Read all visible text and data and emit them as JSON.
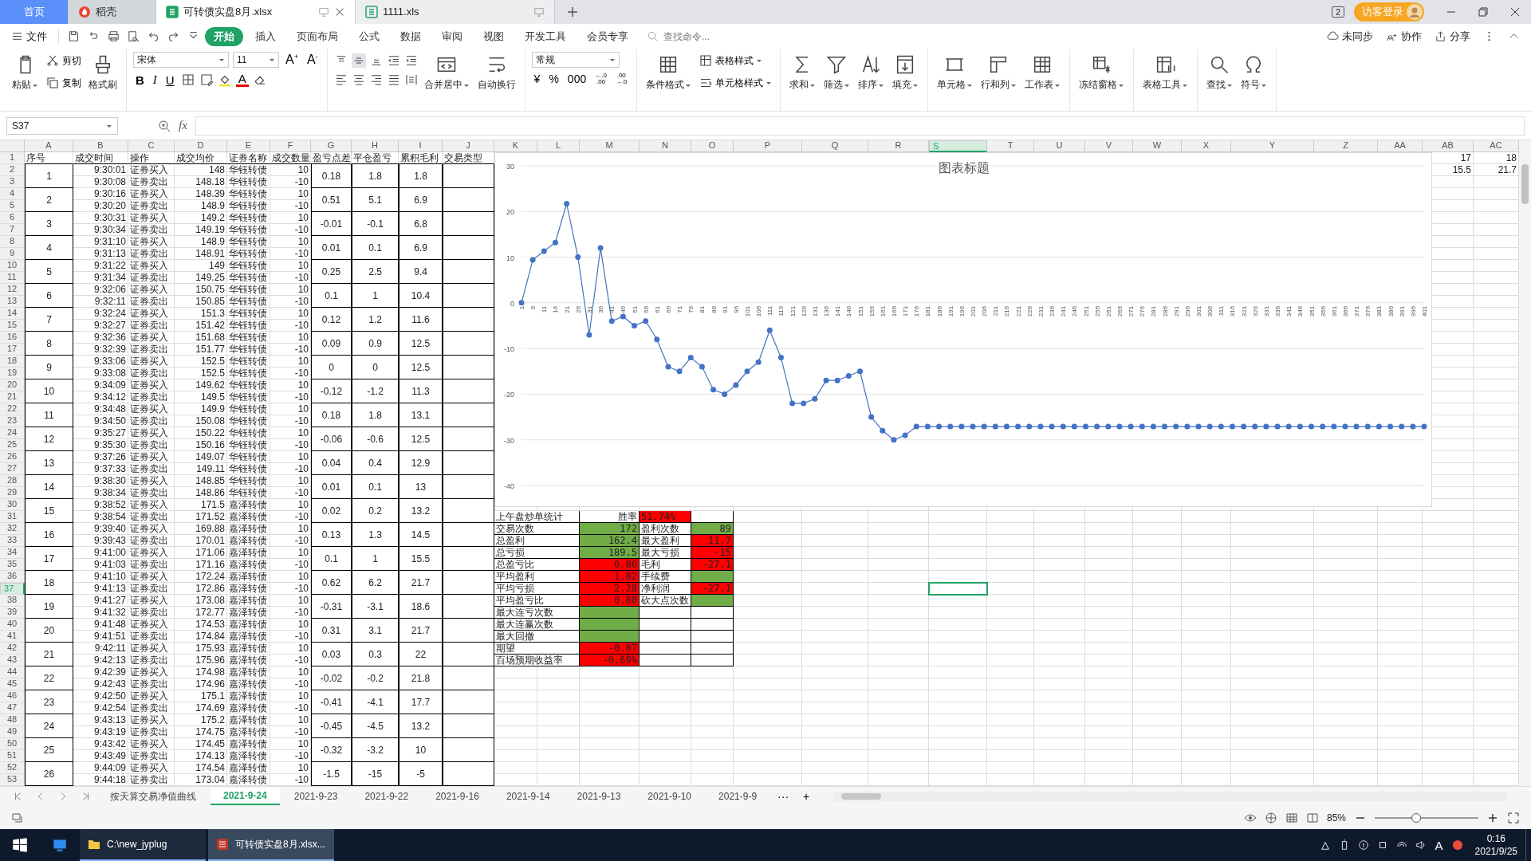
{
  "doc_tabs": [
    {
      "label": "首页",
      "selected": false,
      "kind": "home"
    },
    {
      "label": "稻壳",
      "selected": false,
      "kind": "app"
    },
    {
      "label": "可转债实盘8月.xlsx",
      "selected": true,
      "kind": "sheet"
    },
    {
      "label": "1111.xls",
      "selected": false,
      "kind": "sheet"
    }
  ],
  "screen_badge": "2",
  "login": "访客登录",
  "file_menu": "文件",
  "menu_tabs": [
    {
      "label": "开始",
      "selected": true
    },
    {
      "label": "插入",
      "selected": false
    },
    {
      "label": "页面布局",
      "selected": false
    },
    {
      "label": "公式",
      "selected": false
    },
    {
      "label": "数据",
      "selected": false
    },
    {
      "label": "审阅",
      "selected": false
    },
    {
      "label": "视图",
      "selected": false
    },
    {
      "label": "开发工具",
      "selected": false
    },
    {
      "label": "会员专享",
      "selected": false
    }
  ],
  "command_search": {
    "placeholder": "查找命令..."
  },
  "menu_actions": [
    "未同步",
    "协作",
    "分享"
  ],
  "ribbon_groups": [
    {
      "items": [
        {
          "kind": "big",
          "label": "粘贴",
          "menu": true
        },
        {
          "kind": "stack",
          "items": [
            {
              "label": "剪切",
              "menu": false
            },
            {
              "label": "复制",
              "menu": false
            }
          ]
        },
        {
          "kind": "big",
          "label": "格式刷",
          "menu": false
        }
      ]
    },
    {
      "items": [
        {
          "kind": "font",
          "font": "宋体",
          "size": "11",
          "grow": {
            "text": "A",
            "mark": "+"
          },
          "shrink": {
            "text": "A",
            "mark": "-"
          },
          "styles": [
            "B",
            "I",
            "U"
          ],
          "color_label": "A"
        }
      ]
    },
    {
      "items": [
        {
          "kind": "align"
        },
        {
          "kind": "big",
          "label": "合并居中",
          "menu": true
        },
        {
          "kind": "big",
          "label": "自动换行",
          "menu": false
        }
      ]
    },
    {
      "items": [
        {
          "kind": "number",
          "format": "常规",
          "symbols": [
            "¥",
            "%",
            "000"
          ],
          "decimals": [
            {
              "top": "←.0",
              "bottom": ".00"
            },
            {
              "top": ".00",
              "bottom": "→.0"
            }
          ]
        }
      ]
    },
    {
      "items": [
        {
          "kind": "big",
          "label": "条件格式",
          "menu": true
        },
        {
          "kind": "stack",
          "items": [
            {
              "label": "表格样式",
              "menu": true
            },
            {
              "label": "单元格样式",
              "menu": true
            }
          ]
        }
      ]
    },
    {
      "items": [
        {
          "kind": "big",
          "label": "求和",
          "menu": true
        },
        {
          "kind": "big",
          "label": "筛选",
          "menu": true
        },
        {
          "kind": "big",
          "label": "排序",
          "menu": true
        },
        {
          "kind": "big",
          "label": "填充",
          "menu": true
        }
      ]
    },
    {
      "items": [
        {
          "kind": "big",
          "label": "单元格",
          "menu": true
        },
        {
          "kind": "big",
          "label": "行和列",
          "menu": true
        },
        {
          "kind": "big",
          "label": "工作表",
          "menu": true
        }
      ]
    },
    {
      "items": [
        {
          "kind": "big",
          "label": "冻结窗格",
          "menu": true
        }
      ]
    },
    {
      "items": [
        {
          "kind": "big",
          "label": "表格工具",
          "menu": true
        }
      ]
    },
    {
      "items": [
        {
          "kind": "big",
          "label": "查找",
          "menu": true
        },
        {
          "kind": "big",
          "label": "符号",
          "menu": true
        }
      ]
    }
  ],
  "formula_bar": {
    "cell": "S37",
    "fx": "fx"
  },
  "sheet": {
    "columns": [
      {
        "label": "A",
        "selected": false
      },
      {
        "label": "B",
        "selected": false
      },
      {
        "label": "C",
        "selected": false
      },
      {
        "label": "D",
        "selected": false
      },
      {
        "label": "E",
        "selected": false
      },
      {
        "label": "F",
        "selected": false
      },
      {
        "label": "G",
        "selected": false
      },
      {
        "label": "H",
        "selected": false
      },
      {
        "label": "I",
        "selected": false
      },
      {
        "label": "J",
        "selected": false
      },
      {
        "label": "K",
        "selected": false
      },
      {
        "label": "L",
        "selected": false
      },
      {
        "label": "M",
        "selected": false
      },
      {
        "label": "N",
        "selected": false
      },
      {
        "label": "O",
        "selected": false
      },
      {
        "label": "P",
        "selected": false
      },
      {
        "label": "Q",
        "selected": false
      },
      {
        "label": "R",
        "selected": false
      },
      {
        "label": "S",
        "selected": true
      },
      {
        "label": "T",
        "selected": false
      },
      {
        "label": "U",
        "selected": false
      },
      {
        "label": "V",
        "selected": false
      },
      {
        "label": "W",
        "selected": false
      },
      {
        "label": "X",
        "selected": false
      },
      {
        "label": "Y",
        "selected": false
      },
      {
        "label": "Z",
        "selected": false
      },
      {
        "label": "AA",
        "selected": false
      },
      {
        "label": "AB",
        "selected": false
      },
      {
        "label": "AC",
        "selected": false
      }
    ],
    "rows": [
      {
        "label": "1",
        "selected": false
      },
      {
        "label": "2",
        "selected": false
      },
      {
        "label": "3",
        "selected": false
      },
      {
        "label": "4",
        "selected": false
      },
      {
        "label": "5",
        "selected": false
      },
      {
        "label": "6",
        "selected": false
      },
      {
        "label": "7",
        "selected": false
      },
      {
        "label": "8",
        "selected": false
      },
      {
        "label": "9",
        "selected": false
      },
      {
        "label": "10",
        "selected": false
      },
      {
        "label": "11",
        "selected": false
      },
      {
        "label": "12",
        "selected": false
      },
      {
        "label": "13",
        "selected": false
      },
      {
        "label": "14",
        "selected": false
      },
      {
        "label": "15",
        "selected": false
      },
      {
        "label": "16",
        "selected": false
      },
      {
        "label": "17",
        "selected": false
      },
      {
        "label": "18",
        "selected": false
      },
      {
        "label": "19",
        "selected": false
      },
      {
        "label": "20",
        "selected": false
      },
      {
        "label": "21",
        "selected": false
      },
      {
        "label": "22",
        "selected": false
      },
      {
        "label": "23",
        "selected": false
      },
      {
        "label": "24",
        "selected": false
      },
      {
        "label": "25",
        "selected": false
      },
      {
        "label": "26",
        "selected": false
      },
      {
        "label": "27",
        "selected": false
      },
      {
        "label": "28",
        "selected": false
      },
      {
        "label": "29",
        "selected": false
      },
      {
        "label": "30",
        "selected": false
      },
      {
        "label": "31",
        "selected": false
      },
      {
        "label": "32",
        "selected": false
      },
      {
        "label": "33",
        "selected": false
      },
      {
        "label": "34",
        "selected": false
      },
      {
        "label": "35",
        "selected": false
      },
      {
        "label": "36",
        "selected": false
      },
      {
        "label": "37",
        "selected": true
      },
      {
        "label": "38",
        "selected": false
      },
      {
        "label": "39",
        "selected": false
      },
      {
        "label": "40",
        "selected": false
      },
      {
        "label": "41",
        "selected": false
      },
      {
        "label": "42",
        "selected": false
      },
      {
        "label": "43",
        "selected": false
      },
      {
        "label": "44",
        "selected": false
      },
      {
        "label": "45",
        "selected": false
      },
      {
        "label": "46",
        "selected": false
      },
      {
        "label": "47",
        "selected": false
      },
      {
        "label": "48",
        "selected": false
      },
      {
        "label": "49",
        "selected": false
      },
      {
        "label": "50",
        "selected": false
      },
      {
        "label": "51",
        "selected": false
      },
      {
        "label": "52",
        "selected": false
      },
      {
        "label": "53",
        "selected": false
      }
    ],
    "headers": [
      "序号",
      "成交时间",
      "操作",
      "成交均价",
      "证券名称",
      "成交数量",
      "盈亏点差",
      "平仓盈亏",
      "累积毛利",
      "交易类型"
    ],
    "trades": [
      {
        "no": "1",
        "legs": [
          {
            "time": "9:30:01",
            "action": "证券买入",
            "price": "148",
            "security": "华钰转债",
            "qty": "10"
          },
          {
            "time": "9:30:08",
            "action": "证券卖出",
            "price": "148.18",
            "security": "华钰转债",
            "qty": "-10"
          }
        ],
        "diff": "0.18",
        "pnl": "1.8",
        "cum": "1.8"
      },
      {
        "no": "2",
        "legs": [
          {
            "time": "9:30:16",
            "action": "证券买入",
            "price": "148.39",
            "security": "华钰转债",
            "qty": "10"
          },
          {
            "time": "9:30:20",
            "action": "证券卖出",
            "price": "148.9",
            "security": "华钰转债",
            "qty": "-10"
          }
        ],
        "diff": "0.51",
        "pnl": "5.1",
        "cum": "6.9"
      },
      {
        "no": "3",
        "legs": [
          {
            "time": "9:30:31",
            "action": "证券买入",
            "price": "149.2",
            "security": "华钰转债",
            "qty": "10"
          },
          {
            "time": "9:30:34",
            "action": "证券卖出",
            "price": "149.19",
            "security": "华钰转债",
            "qty": "-10"
          }
        ],
        "diff": "-0.01",
        "pnl": "-0.1",
        "cum": "6.8"
      },
      {
        "no": "4",
        "legs": [
          {
            "time": "9:31:10",
            "action": "证券买入",
            "price": "148.9",
            "security": "华钰转债",
            "qty": "10"
          },
          {
            "time": "9:31:13",
            "action": "证券卖出",
            "price": "148.91",
            "security": "华钰转债",
            "qty": "-10"
          }
        ],
        "diff": "0.01",
        "pnl": "0.1",
        "cum": "6.9"
      },
      {
        "no": "5",
        "legs": [
          {
            "time": "9:31:22",
            "action": "证券买入",
            "price": "149",
            "security": "华钰转债",
            "qty": "10"
          },
          {
            "time": "9:31:34",
            "action": "证券卖出",
            "price": "149.25",
            "security": "华钰转债",
            "qty": "-10"
          }
        ],
        "diff": "0.25",
        "pnl": "2.5",
        "cum": "9.4"
      },
      {
        "no": "6",
        "legs": [
          {
            "time": "9:32:06",
            "action": "证券买入",
            "price": "150.75",
            "security": "华钰转债",
            "qty": "10"
          },
          {
            "time": "9:32:11",
            "action": "证券卖出",
            "price": "150.85",
            "security": "华钰转债",
            "qty": "-10"
          }
        ],
        "diff": "0.1",
        "pnl": "1",
        "cum": "10.4"
      },
      {
        "no": "7",
        "legs": [
          {
            "time": "9:32:24",
            "action": "证券买入",
            "price": "151.3",
            "security": "华钰转债",
            "qty": "10"
          },
          {
            "time": "9:32:27",
            "action": "证券卖出",
            "price": "151.42",
            "security": "华钰转债",
            "qty": "-10"
          }
        ],
        "diff": "0.12",
        "pnl": "1.2",
        "cum": "11.6"
      },
      {
        "no": "8",
        "legs": [
          {
            "time": "9:32:36",
            "action": "证券买入",
            "price": "151.68",
            "security": "华钰转债",
            "qty": "10"
          },
          {
            "time": "9:32:39",
            "action": "证券卖出",
            "price": "151.77",
            "security": "华钰转债",
            "qty": "-10"
          }
        ],
        "diff": "0.09",
        "pnl": "0.9",
        "cum": "12.5"
      },
      {
        "no": "9",
        "legs": [
          {
            "time": "9:33:06",
            "action": "证券买入",
            "price": "152.5",
            "security": "华钰转债",
            "qty": "10"
          },
          {
            "time": "9:33:08",
            "action": "证券卖出",
            "price": "152.5",
            "security": "华钰转债",
            "qty": "-10"
          }
        ],
        "diff": "0",
        "pnl": "0",
        "cum": "12.5"
      },
      {
        "no": "10",
        "legs": [
          {
            "time": "9:34:09",
            "action": "证券买入",
            "price": "149.62",
            "security": "华钰转债",
            "qty": "10"
          },
          {
            "time": "9:34:12",
            "action": "证券卖出",
            "price": "149.5",
            "security": "华钰转债",
            "qty": "-10"
          }
        ],
        "diff": "-0.12",
        "pnl": "-1.2",
        "cum": "11.3"
      },
      {
        "no": "11",
        "legs": [
          {
            "time": "9:34:48",
            "action": "证券买入",
            "price": "149.9",
            "security": "华钰转债",
            "qty": "10"
          },
          {
            "time": "9:34:50",
            "action": "证券卖出",
            "price": "150.08",
            "security": "华钰转债",
            "qty": "-10"
          }
        ],
        "diff": "0.18",
        "pnl": "1.8",
        "cum": "13.1"
      },
      {
        "no": "12",
        "legs": [
          {
            "time": "9:35:27",
            "action": "证券买入",
            "price": "150.22",
            "security": "华钰转债",
            "qty": "10"
          },
          {
            "time": "9:35:30",
            "action": "证券卖出",
            "price": "150.16",
            "security": "华钰转债",
            "qty": "-10"
          }
        ],
        "diff": "-0.06",
        "pnl": "-0.6",
        "cum": "12.5"
      },
      {
        "no": "13",
        "legs": [
          {
            "time": "9:37:26",
            "action": "证券买入",
            "price": "149.07",
            "security": "华钰转债",
            "qty": "10"
          },
          {
            "time": "9:37:33",
            "action": "证券卖出",
            "price": "149.11",
            "security": "华钰转债",
            "qty": "-10"
          }
        ],
        "diff": "0.04",
        "pnl": "0.4",
        "cum": "12.9"
      },
      {
        "no": "14",
        "legs": [
          {
            "time": "9:38:30",
            "action": "证券买入",
            "price": "148.85",
            "security": "华钰转债",
            "qty": "10"
          },
          {
            "time": "9:38:34",
            "action": "证券卖出",
            "price": "148.86",
            "security": "华钰转债",
            "qty": "-10"
          }
        ],
        "diff": "0.01",
        "pnl": "0.1",
        "cum": "13"
      },
      {
        "no": "15",
        "legs": [
          {
            "time": "9:38:52",
            "action": "证券买入",
            "price": "171.5",
            "security": "嘉泽转债",
            "qty": "10"
          },
          {
            "time": "9:38:54",
            "action": "证券卖出",
            "price": "171.52",
            "security": "嘉泽转债",
            "qty": "-10"
          }
        ],
        "diff": "0.02",
        "pnl": "0.2",
        "cum": "13.2"
      },
      {
        "no": "16",
        "legs": [
          {
            "time": "9:39:40",
            "action": "证券买入",
            "price": "169.88",
            "security": "嘉泽转债",
            "qty": "10"
          },
          {
            "time": "9:39:43",
            "action": "证券卖出",
            "price": "170.01",
            "security": "嘉泽转债",
            "qty": "-10"
          }
        ],
        "diff": "0.13",
        "pnl": "1.3",
        "cum": "14.5"
      },
      {
        "no": "17",
        "legs": [
          {
            "time": "9:41:00",
            "action": "证券买入",
            "price": "171.06",
            "security": "嘉泽转债",
            "qty": "10"
          },
          {
            "time": "9:41:03",
            "action": "证券卖出",
            "price": "171.16",
            "security": "嘉泽转债",
            "qty": "-10"
          }
        ],
        "diff": "0.1",
        "pnl": "1",
        "cum": "15.5"
      },
      {
        "no": "18",
        "legs": [
          {
            "time": "9:41:10",
            "action": "证券买入",
            "price": "172.24",
            "security": "嘉泽转债",
            "qty": "10"
          },
          {
            "time": "9:41:13",
            "action": "证券卖出",
            "price": "172.86",
            "security": "嘉泽转债",
            "qty": "-10"
          }
        ],
        "diff": "0.62",
        "pnl": "6.2",
        "cum": "21.7"
      },
      {
        "no": "19",
        "legs": [
          {
            "time": "9:41:27",
            "action": "证券买入",
            "price": "173.08",
            "security": "嘉泽转债",
            "qty": "10"
          },
          {
            "time": "9:41:32",
            "action": "证券卖出",
            "price": "172.77",
            "security": "嘉泽转债",
            "qty": "-10"
          }
        ],
        "diff": "-0.31",
        "pnl": "-3.1",
        "cum": "18.6"
      },
      {
        "no": "20",
        "legs": [
          {
            "time": "9:41:48",
            "action": "证券买入",
            "price": "174.53",
            "security": "嘉泽转债",
            "qty": "10"
          },
          {
            "time": "9:41:51",
            "action": "证券卖出",
            "price": "174.84",
            "security": "嘉泽转债",
            "qty": "-10"
          }
        ],
        "diff": "0.31",
        "pnl": "3.1",
        "cum": "21.7"
      },
      {
        "no": "21",
        "legs": [
          {
            "time": "9:42:11",
            "action": "证券买入",
            "price": "175.93",
            "security": "嘉泽转债",
            "qty": "10"
          },
          {
            "time": "9:42:13",
            "action": "证券卖出",
            "price": "175.96",
            "security": "嘉泽转债",
            "qty": "-10"
          }
        ],
        "diff": "0.03",
        "pnl": "0.3",
        "cum": "22"
      },
      {
        "no": "22",
        "legs": [
          {
            "time": "9:42:39",
            "action": "证券买入",
            "price": "174.98",
            "security": "嘉泽转债",
            "qty": "10"
          },
          {
            "time": "9:42:43",
            "action": "证券卖出",
            "price": "174.96",
            "security": "嘉泽转债",
            "qty": "-10"
          }
        ],
        "diff": "-0.02",
        "pnl": "-0.2",
        "cum": "21.8"
      },
      {
        "no": "23",
        "legs": [
          {
            "time": "9:42:50",
            "action": "证券买入",
            "price": "175.1",
            "security": "嘉泽转债",
            "qty": "10"
          },
          {
            "time": "9:42:54",
            "action": "证券卖出",
            "price": "174.69",
            "security": "嘉泽转债",
            "qty": "-10"
          }
        ],
        "diff": "-0.41",
        "pnl": "-4.1",
        "cum": "17.7"
      },
      {
        "no": "24",
        "legs": [
          {
            "time": "9:43:13",
            "action": "证券买入",
            "price": "175.2",
            "security": "嘉泽转债",
            "qty": "10"
          },
          {
            "time": "9:43:19",
            "action": "证券卖出",
            "price": "174.75",
            "security": "嘉泽转债",
            "qty": "-10"
          }
        ],
        "diff": "-0.45",
        "pnl": "-4.5",
        "cum": "13.2"
      },
      {
        "no": "25",
        "legs": [
          {
            "time": "9:43:42",
            "action": "证券买入",
            "price": "174.45",
            "security": "嘉泽转债",
            "qty": "10"
          },
          {
            "time": "9:43:49",
            "action": "证券卖出",
            "price": "174.13",
            "security": "嘉泽转债",
            "qty": "-10"
          }
        ],
        "diff": "-0.32",
        "pnl": "-3.2",
        "cum": "10"
      },
      {
        "no": "26",
        "legs": [
          {
            "time": "9:44:09",
            "action": "证券买入",
            "price": "174.54",
            "security": "嘉泽转债",
            "qty": "10"
          },
          {
            "time": "9:44:18",
            "action": "证券卖出",
            "price": "173.04",
            "security": "嘉泽转债",
            "qty": "-10"
          }
        ],
        "diff": "-1.5",
        "pnl": "-15",
        "cum": "-5"
      }
    ],
    "stats": [
      [
        {
          "text": "上午盘炒单统计"
        },
        {
          "text": "胜率"
        },
        {
          "text": "51.74%",
          "color": "#ff0000"
        }
      ],
      [
        {
          "text": "交易次数"
        },
        {
          "text": "172",
          "color": "#70ad47"
        },
        {
          "text": "盈利次数"
        },
        {
          "text": "89",
          "color": "#70ad47"
        }
      ],
      [
        {
          "text": "总盈利"
        },
        {
          "text": "162.4",
          "color": "#70ad47"
        },
        {
          "text": "最大盈利"
        },
        {
          "text": "11.7",
          "color": "#ff0000"
        }
      ],
      [
        {
          "text": "总亏损"
        },
        {
          "text": "189.5",
          "color": "#70ad47"
        },
        {
          "text": "最大亏损"
        },
        {
          "text": "-15",
          "color": "#ff0000"
        }
      ],
      [
        {
          "text": "总盈亏比"
        },
        {
          "text": "0.86",
          "color": "#ff0000"
        },
        {
          "text": "毛利"
        },
        {
          "text": "-27.1",
          "color": "#ff0000"
        }
      ],
      [
        {
          "text": "平均盈利"
        },
        {
          "text": "1.82",
          "color": "#ff0000"
        },
        {
          "text": "手续费"
        },
        {
          "color": "#70ad47"
        }
      ],
      [
        {
          "text": "平均亏损"
        },
        {
          "text": "2.28",
          "color": "#ff0000"
        },
        {
          "text": "净利润"
        },
        {
          "text": "-27.1",
          "color": "#ff0000"
        }
      ],
      [
        {
          "text": "平均盈亏比"
        },
        {
          "text": "0.80",
          "color": "#ff0000"
        },
        {
          "text": "砍大点次数"
        },
        {
          "color": "#70ad47"
        }
      ],
      [
        {
          "text": "最大连亏次数"
        },
        {
          "color": "#70ad47"
        }
      ],
      [
        {
          "text": "最大连赢次数"
        },
        {
          "color": "#70ad47"
        }
      ],
      [
        {
          "text": "最大回撤"
        },
        {
          "color": "#70ad47"
        }
      ],
      [
        {
          "text": "期望"
        },
        {
          "text": "-0.07",
          "color": "#ff0000"
        }
      ],
      [
        {
          "text": "百场预期收益率"
        },
        {
          "text": "-0.69%",
          "color": "#ff0000"
        }
      ]
    ],
    "right_cells": [
      [
        "17",
        "18"
      ],
      [
        "15.5",
        "21.7"
      ]
    ]
  },
  "chart": {
    "chart_data": {
      "type": "line",
      "title": "图表标题",
      "ylim": [
        -40,
        30
      ],
      "grid": true,
      "categories": [
        "1",
        "6",
        "11",
        "16",
        "21",
        "26",
        "31",
        "36",
        "41",
        "46",
        "51",
        "56",
        "61",
        "66",
        "71",
        "76",
        "81",
        "86",
        "91",
        "96",
        "101",
        "106",
        "111",
        "116",
        "121",
        "126",
        "131",
        "136",
        "141",
        "146",
        "151",
        "156",
        "161",
        "166",
        "171",
        "176",
        "181",
        "186",
        "191",
        "196",
        "201",
        "206",
        "211",
        "216",
        "221",
        "226",
        "231",
        "236",
        "241",
        "246",
        "251",
        "256",
        "261",
        "266",
        "271",
        "276",
        "281",
        "286",
        "291",
        "296",
        "301",
        "306",
        "311",
        "316",
        "321",
        "326",
        "331",
        "336",
        "341",
        "346",
        "351",
        "356",
        "361",
        "366",
        "371",
        "376",
        "381",
        "386",
        "391",
        "396",
        "401"
      ],
      "yticks": [
        -40,
        -30,
        -20,
        -10,
        0,
        10,
        20,
        30
      ],
      "series": [
        {
          "color": "#4472c4",
          "marker": "circle",
          "values": [
            0,
            9.4,
            11.3,
            13.2,
            21.7,
            10,
            -7,
            12,
            -4,
            -3,
            -5,
            -4,
            -8,
            -14,
            -15,
            -12,
            -14,
            -19,
            -20,
            -18,
            -15,
            -13,
            -6,
            -12,
            -22,
            -22,
            -21,
            -17,
            -17,
            -16,
            -15,
            -25,
            -28,
            -30,
            -29,
            -27.1,
            -27.1,
            -27.1,
            -27.1,
            -27.1,
            -27.1,
            -27.1,
            -27.1,
            -27.1,
            -27.1,
            -27.1,
            -27.1,
            -27.1,
            -27.1,
            -27.1,
            -27.1,
            -27.1,
            -27.1,
            -27.1,
            -27.1,
            -27.1,
            -27.1,
            -27.1,
            -27.1,
            -27.1,
            -27.1,
            -27.1,
            -27.1,
            -27.1,
            -27.1,
            -27.1,
            -27.1,
            -27.1,
            -27.1,
            -27.1,
            -27.1,
            -27.1,
            -27.1,
            -27.1,
            -27.1,
            -27.1,
            -27.1,
            -27.1,
            -27.1,
            -27.1,
            -27.1
          ]
        }
      ]
    }
  },
  "sheet_tabs": [
    {
      "label": "按天算交易净值曲线",
      "selected": false
    },
    {
      "label": "2021-9-24",
      "selected": true
    },
    {
      "label": "2021-9-23",
      "selected": false
    },
    {
      "label": "2021-9-22",
      "selected": false
    },
    {
      "label": "2021-9-16",
      "selected": false
    },
    {
      "label": "2021-9-14",
      "selected": false
    },
    {
      "label": "2021-9-13",
      "selected": false
    },
    {
      "label": "2021-9-10",
      "selected": false
    },
    {
      "label": "2021-9-9",
      "selected": false
    }
  ],
  "more_tabs": "···",
  "add_tab": "+",
  "zoom": {
    "text": "85%",
    "level": 0.4
  },
  "taskbar": {
    "items": [
      {
        "label": "C:\\new_jyplug",
        "selected": false
      },
      {
        "label": "可转债实盘8月.xlsx...",
        "selected": true
      }
    ],
    "ime": "A",
    "time": "0:16",
    "date": "2021/9/25"
  }
}
